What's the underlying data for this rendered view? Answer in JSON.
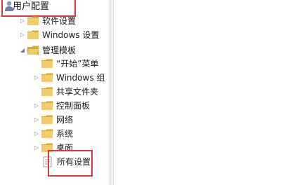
{
  "tree": {
    "root": {
      "label": "用户配置",
      "icon": "user-config-icon"
    },
    "nodes": [
      {
        "label": "软件设置",
        "expander": "▷"
      },
      {
        "label": "Windows 设置",
        "expander": "▷"
      },
      {
        "label": "管理模板",
        "expander": "◢"
      },
      {
        "label": "“开始”菜单",
        "expander": ""
      },
      {
        "label": "Windows 组",
        "expander": "▷"
      },
      {
        "label": "共享文件夹",
        "expander": ""
      },
      {
        "label": "控制面板",
        "expander": "▷"
      },
      {
        "label": "网络",
        "expander": "▷"
      },
      {
        "label": "系统",
        "expander": "▷"
      },
      {
        "label": "桌面",
        "expander": "▷"
      },
      {
        "label": "所有设置",
        "expander": ""
      }
    ]
  },
  "colors": {
    "highlight": "#d63b3b",
    "folder": "#f2cc6b",
    "folder_dark": "#d9a93a"
  }
}
